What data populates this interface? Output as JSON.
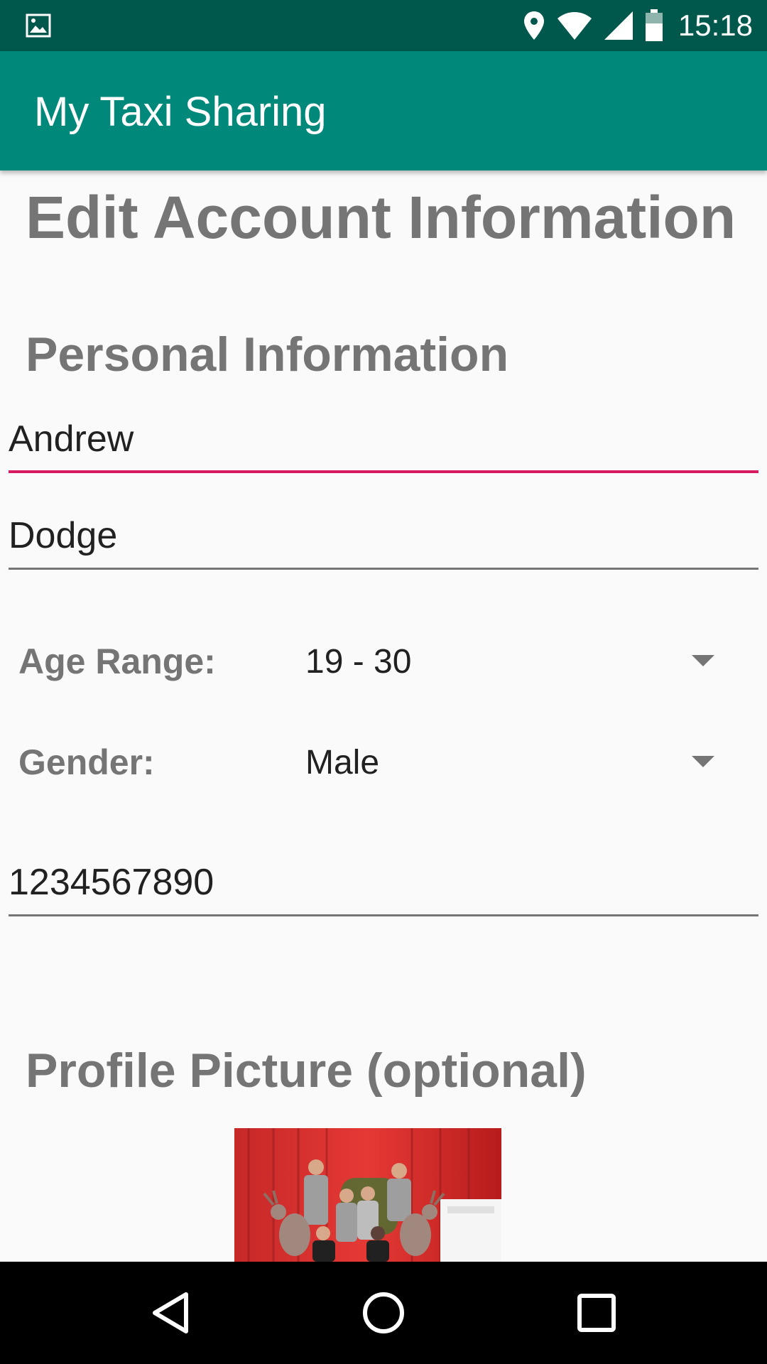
{
  "status_bar": {
    "time": "15:18",
    "icons": [
      "image-notification-icon",
      "location-icon",
      "wifi-icon",
      "signal-icon",
      "battery-icon"
    ]
  },
  "app_bar": {
    "title": "My Taxi Sharing"
  },
  "page": {
    "title": "Edit Account Information",
    "personal_section_title": "Personal Information",
    "first_name": "Andrew",
    "last_name": "Dodge",
    "age_range": {
      "label": "Age Range:",
      "value": "19 - 30"
    },
    "gender": {
      "label": "Gender:",
      "value": "Male"
    },
    "phone": "1234567890",
    "profile_section_title": "Profile Picture (optional)"
  },
  "nav_bar": {
    "icons": [
      "back-icon",
      "home-icon",
      "recents-icon"
    ]
  },
  "colors": {
    "status_bar": "#00574b",
    "app_bar": "#00897b",
    "accent": "#d81b60",
    "heading_gray": "#757575"
  }
}
